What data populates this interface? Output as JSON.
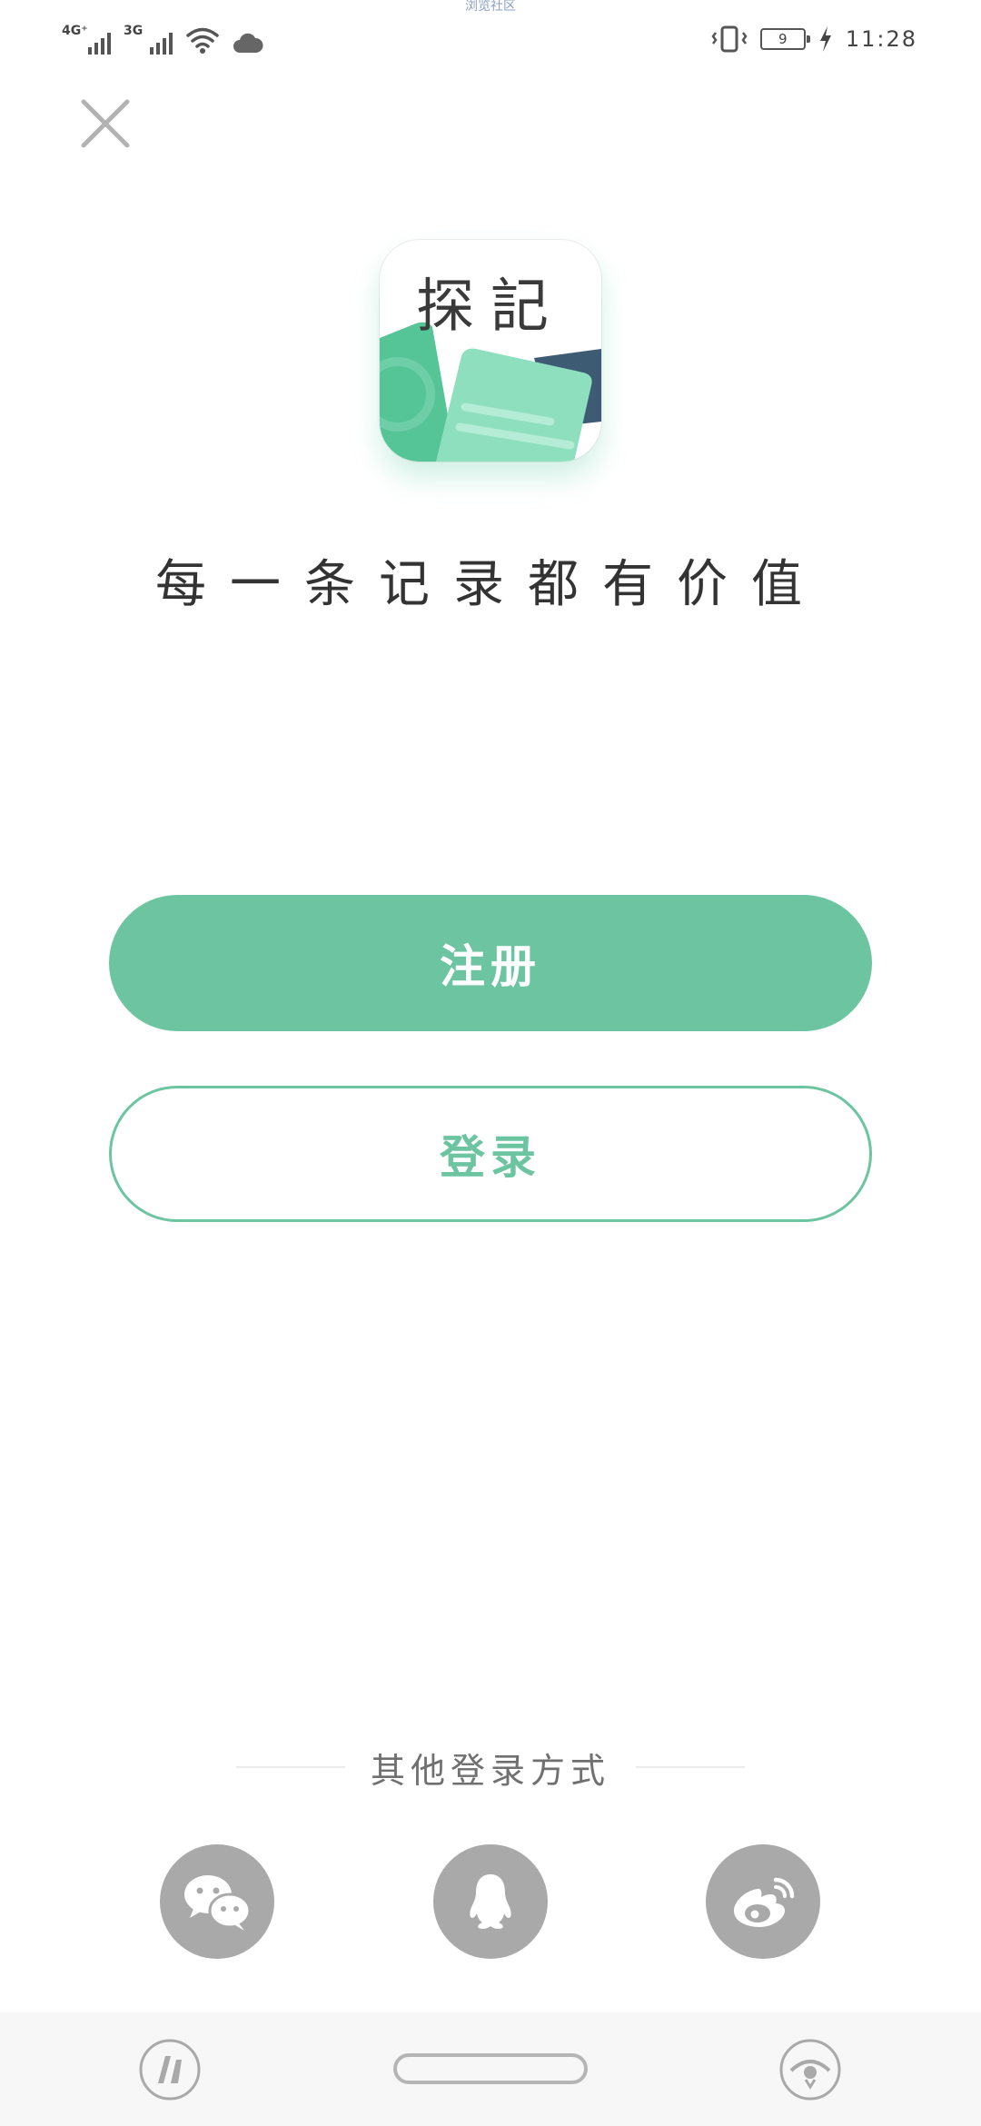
{
  "status_bar": {
    "top_caption": "浏览社区",
    "net1": "4G⁺",
    "net2": "3G",
    "battery_level": "9",
    "time": "11:28"
  },
  "close": {
    "icon": "close-icon"
  },
  "app_icon": {
    "title": "探記",
    "colors": {
      "green": "#55c497",
      "light_green": "#8ddfbe",
      "dark_blue": "#3e5b74"
    }
  },
  "tagline": "每一条记录都有价值",
  "buttons": {
    "register": "注册",
    "login": "登录"
  },
  "other_login": {
    "label": "其他登录方式",
    "methods": [
      {
        "name": "wechat",
        "icon": "wechat-icon"
      },
      {
        "name": "qq",
        "icon": "qq-icon"
      },
      {
        "name": "weibo",
        "icon": "weibo-icon"
      }
    ]
  },
  "colors": {
    "accent": "#6cc5a0",
    "social_bg": "#a9a9a9"
  }
}
